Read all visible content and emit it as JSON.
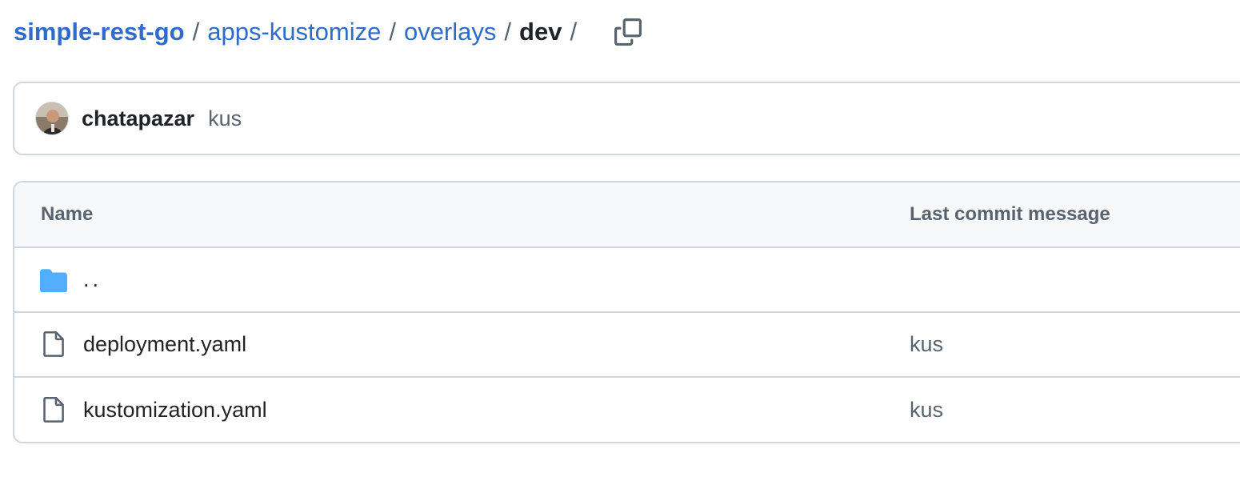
{
  "breadcrumb": {
    "repo": "simple-rest-go",
    "parts": [
      "apps-kustomize",
      "overlays"
    ],
    "current": "dev",
    "separator": "/"
  },
  "latest_commit": {
    "author": "chatapazar",
    "message": "kus"
  },
  "file_table": {
    "headers": {
      "name": "Name",
      "last_commit_message": "Last commit message"
    },
    "parent_dir": "..",
    "files": [
      {
        "name": "deployment.yaml",
        "message": "kus",
        "icon": "file-icon"
      },
      {
        "name": "kustomization.yaml",
        "message": "kus",
        "icon": "file-icon"
      }
    ]
  },
  "colors": {
    "link": "#2f6bcc",
    "folder": "#54aeff",
    "border": "#d0d7de",
    "muted": "#59636e"
  }
}
